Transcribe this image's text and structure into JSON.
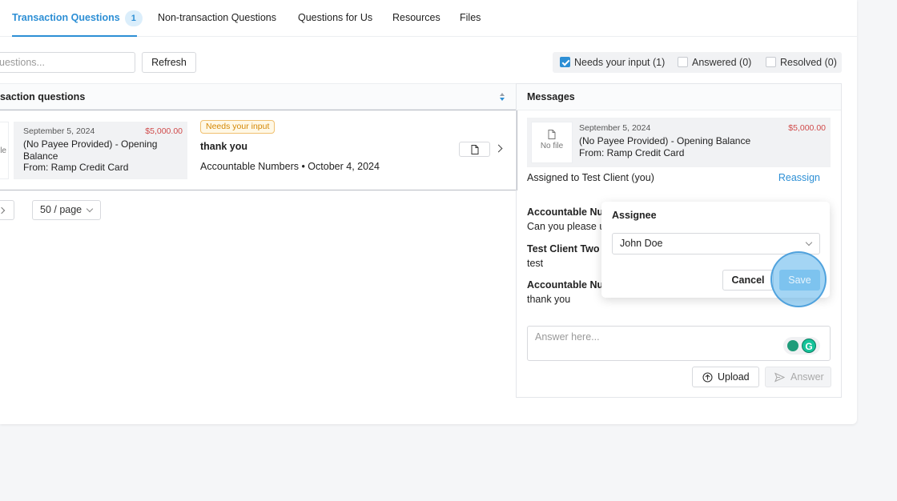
{
  "tabs": [
    {
      "label": "Transaction Questions",
      "badge": "1"
    },
    {
      "label": "Non-transaction Questions"
    },
    {
      "label": "Questions for Us"
    },
    {
      "label": "Resources"
    },
    {
      "label": "Files"
    }
  ],
  "toolbar": {
    "search_placeholder": "uestions...",
    "refresh_label": "Refresh"
  },
  "filters": [
    {
      "label": "Needs your input (1)",
      "checked": true
    },
    {
      "label": "Answered (0)",
      "checked": false
    },
    {
      "label": "Resolved (0)",
      "checked": false
    }
  ],
  "list": {
    "header": "saction questions",
    "row": {
      "thumb_text": "ile",
      "date": "September 5, 2024",
      "amount": "$5,000.00",
      "description_line1": "(No Payee Provided)  -  Opening",
      "description_line2": "Balance",
      "from": "From: Ramp Credit Card",
      "status": "Needs your input",
      "question": "thank you",
      "meta": "Accountable Numbers • October 4, 2024"
    },
    "page_size": "50 / page"
  },
  "messages": {
    "header": "Messages",
    "tx": {
      "thumb_text": "No file",
      "date": "September 5, 2024",
      "amount": "$5,000.00",
      "description": "(No Payee Provided)  -  Opening Balance",
      "from": "From: Ramp Credit Card"
    },
    "assigned": "Assigned to Test Client (you)",
    "reassign": "Reassign",
    "items": [
      {
        "author": "Accountable Nur",
        "body": "Can you please u"
      },
      {
        "author": "Test Client Two",
        "body": "test"
      },
      {
        "author": "Accountable Nur",
        "body": "thank you"
      }
    ],
    "answer_placeholder": "Answer here...",
    "upload_label": "Upload",
    "answer_label": "Answer"
  },
  "popover": {
    "title": "Assignee",
    "selected": "John Doe",
    "cancel_label": "Cancel",
    "save_label": "Save"
  },
  "colors": {
    "accent": "#2d8fd5",
    "amount": "#d04a4a",
    "status_pill": "#d48806"
  }
}
